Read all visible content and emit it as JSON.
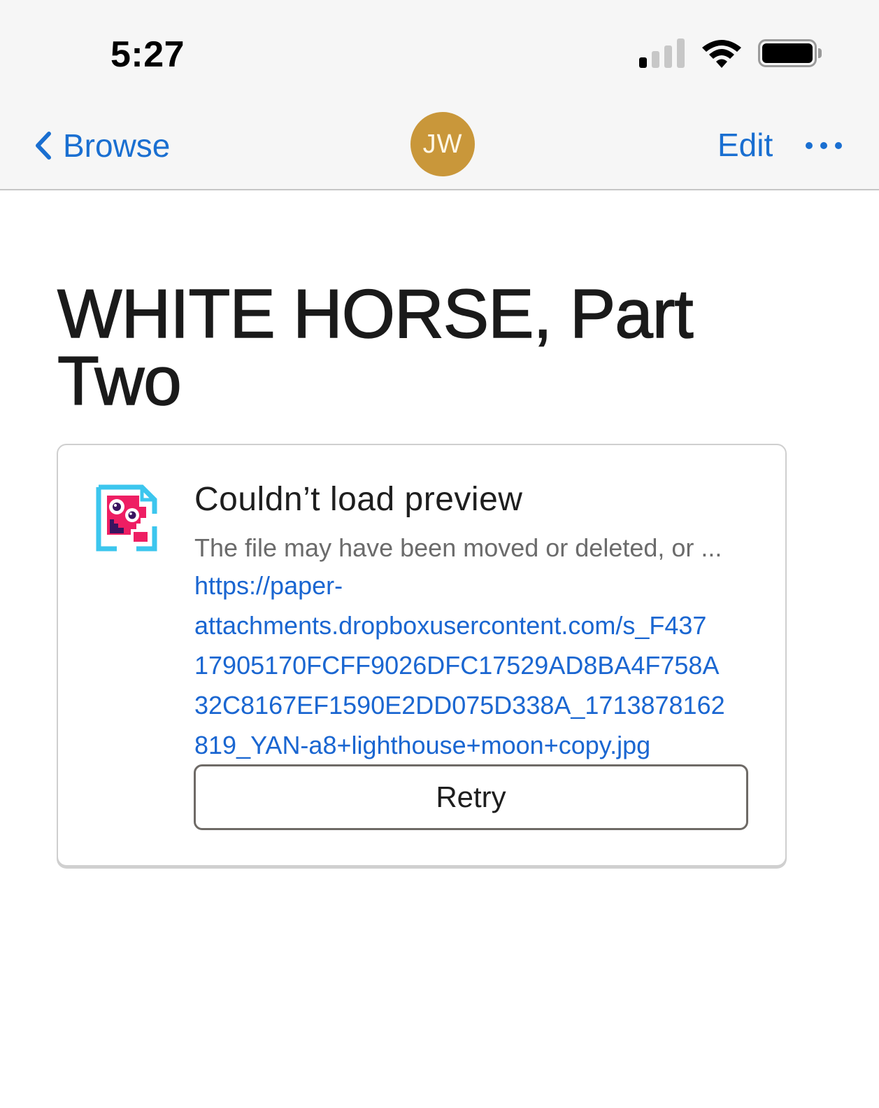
{
  "status_bar": {
    "time": "5:27",
    "signal_icon": "cellular-signal-icon",
    "signal_strength": "1 of 4 bars",
    "wifi_icon": "wifi-icon",
    "battery_icon": "battery-icon",
    "battery_level": 1.0
  },
  "nav": {
    "back_label": "Browse",
    "back_icon": "chevron-left-icon",
    "avatar_initials": "JW",
    "edit_label": "Edit",
    "more_icon": "ellipsis-icon",
    "accent_color": "#1a6fd1",
    "avatar_color": "#c9973a"
  },
  "document": {
    "title": "WHITE HORSE, Part Two"
  },
  "preview_card": {
    "icon": "broken-file-icon",
    "heading": "Couldn’t load preview",
    "message": "The file may have been moved or deleted, or ...",
    "link_lines": [
      "https://paper-",
      "attachments.dropboxusercontent.com/s_F437",
      "17905170FCFF9026DFC17529AD8BA4F758A",
      "32C8167EF1590E2DD075D338A_1713878162",
      "819_YAN-a8+lighthouse+moon+copy.jpg"
    ],
    "retry_label": "Retry"
  }
}
